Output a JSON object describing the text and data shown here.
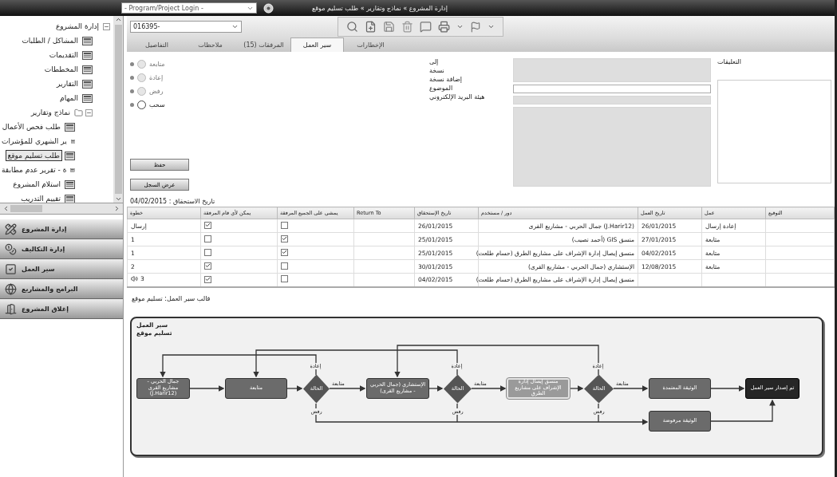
{
  "top_bar": {
    "login_combo": "- Program/Project Login -",
    "breadcrumb": "إدارة المشروع » نماذج وتقارير » طلب تسليم موقع"
  },
  "sidebar": {
    "tree": [
      {
        "label": "إدارة المشروع",
        "expanded": true,
        "selected": false,
        "children": [
          {
            "label": "المشاكل / الطلبات",
            "kind": "form",
            "selected": false
          },
          {
            "label": "التقديمات",
            "kind": "form",
            "selected": false
          },
          {
            "label": "المخططات",
            "kind": "form",
            "selected": false
          },
          {
            "label": "التقارير",
            "kind": "form",
            "selected": false
          },
          {
            "label": "المهام",
            "kind": "form",
            "selected": false
          },
          {
            "label": "نماذج وتقارير",
            "kind": "folder",
            "expanded": true,
            "selected": false,
            "children": [
              {
                "label": "طلب فحص الأعمال",
                "kind": "form",
                "selected": false
              },
              {
                "label": "ير الشهري للمؤشرات",
                "kind": "form",
                "selected": false
              },
              {
                "label": "طلب تسليم موقع",
                "kind": "form",
                "selected": true
              },
              {
                "label": "ة - تقرير عدم مطابقة",
                "kind": "form",
                "selected": false
              },
              {
                "label": "استلام المشروع",
                "kind": "form",
                "selected": false
              },
              {
                "label": "تقييم التدريب",
                "kind": "form",
                "selected": false
              }
            ]
          }
        ]
      }
    ],
    "nav": [
      {
        "label": "إدارة المشروع",
        "kind": "pencil"
      },
      {
        "label": "إدارة التكاليف",
        "kind": "coins"
      },
      {
        "label": "سير العمل",
        "kind": "check"
      },
      {
        "label": "البرامج والمشاريع",
        "kind": "globe"
      },
      {
        "label": "إغلاق المشروع",
        "kind": "door"
      }
    ]
  },
  "record": {
    "value": "016395-"
  },
  "tabs": [
    {
      "label": "الإخطارات",
      "selected": false
    },
    {
      "label": "سير العمل",
      "selected": true
    },
    {
      "label": "المرفقات (15)",
      "selected": false
    },
    {
      "label": "ملاحظات",
      "selected": false
    },
    {
      "label": "التفاصيل",
      "selected": false
    }
  ],
  "form": {
    "actions": [
      {
        "label": "متابعة",
        "selected": false,
        "disabled": true
      },
      {
        "label": "إعادة",
        "selected": false,
        "disabled": true
      },
      {
        "label": "رفض",
        "selected": false,
        "disabled": true
      },
      {
        "label": "سحب",
        "selected": false,
        "disabled": false
      }
    ],
    "buttons": [
      "حفظ",
      "عرض السجل"
    ],
    "email_labels": [
      "إلى",
      "نسخة",
      "إضافة نسخة",
      "الموضوع",
      "هيئة البريد الإلكتروني"
    ],
    "email_fields": [
      {
        "kind": "tall",
        "disabled": true
      },
      {
        "kind": "line",
        "disabled": false
      },
      {
        "kind": "line",
        "disabled": true
      },
      {
        "kind": "area",
        "disabled": true
      }
    ],
    "comments_label": "التعليقات"
  },
  "due_date": "تاريخ الاستحقاق : 04/02/2015",
  "table": {
    "columns": [
      "التوقيع",
      "عمل",
      "تاريخ العمل",
      "دور / مستخدم",
      "تاريخ الإستحقاق",
      "Return To",
      "يمشي على الجميع المرفقة",
      "يمكن لأي قام المرفقة",
      "خطوة"
    ],
    "rows": [
      {
        "step": "إرسال",
        "current": false,
        "any": true,
        "all": false,
        "due": "26/01/2015",
        "role": "(J.Harir12) جمال الحربي - مشاريع القرى",
        "action_date": "26/01/2015",
        "action": "إعادة إرسال"
      },
      {
        "step": "1",
        "current": false,
        "any": false,
        "all": true,
        "due": "25/01/2015",
        "role": "منسق GIS (أحمد نصيب)",
        "action_date": "27/01/2015",
        "action": "متابعة"
      },
      {
        "step": "1",
        "current": false,
        "any": false,
        "all": true,
        "due": "25/01/2015",
        "role": "منسق إيصال إدارة الإشراف على مشاريع الطرق (حسام طلعت)",
        "action_date": "04/02/2015",
        "action": "متابعة"
      },
      {
        "step": "2",
        "current": false,
        "any": true,
        "all": false,
        "due": "30/01/2015",
        "role": "الإستشاري (جمال الحربي - مشاريع القرى)",
        "action_date": "12/08/2015",
        "action": "متابعة"
      },
      {
        "step": "3",
        "current": true,
        "any": true,
        "all": false,
        "due": "04/02/2015",
        "role": "منسق إيصال إدارة الإشراف على مشاريع الطرق (حسام طلعت)"
      }
    ]
  },
  "template_caption": "قالب سير العمل: تسليم موقع",
  "diagram": {
    "title": "سير العمل",
    "subtitle": "تسليم موقع",
    "nodes": [
      {
        "kind": "end",
        "label": "تم إصدار سير العمل"
      },
      {
        "kind": "process",
        "label": "الوثيقة المعتمدة"
      },
      {
        "kind": "process",
        "label": "الوثيقة مرفوضة"
      },
      {
        "kind": "decision",
        "label": "الحالة",
        "return": "إعادة",
        "continue": "متابعة",
        "reject": "رفض"
      },
      {
        "kind": "active",
        "label": "منسق إيصال إدارة الإشراف على مشاريع الطرق"
      },
      {
        "kind": "decision",
        "label": "الحالة",
        "return": "إعادة",
        "continue": "متابعة",
        "reject": "رفض"
      },
      {
        "kind": "process",
        "label": "الإستشاري (جمال الحربي - مشاريع القرى)"
      },
      {
        "kind": "decision",
        "label": "الحالة",
        "return": "إعادة",
        "continue": "متابعة",
        "reject": "رفض"
      },
      {
        "kind": "process",
        "label": "متابعة"
      },
      {
        "kind": "process",
        "label": "جمال الحربي - مشاريع القرى (J.Harir12)"
      }
    ]
  }
}
